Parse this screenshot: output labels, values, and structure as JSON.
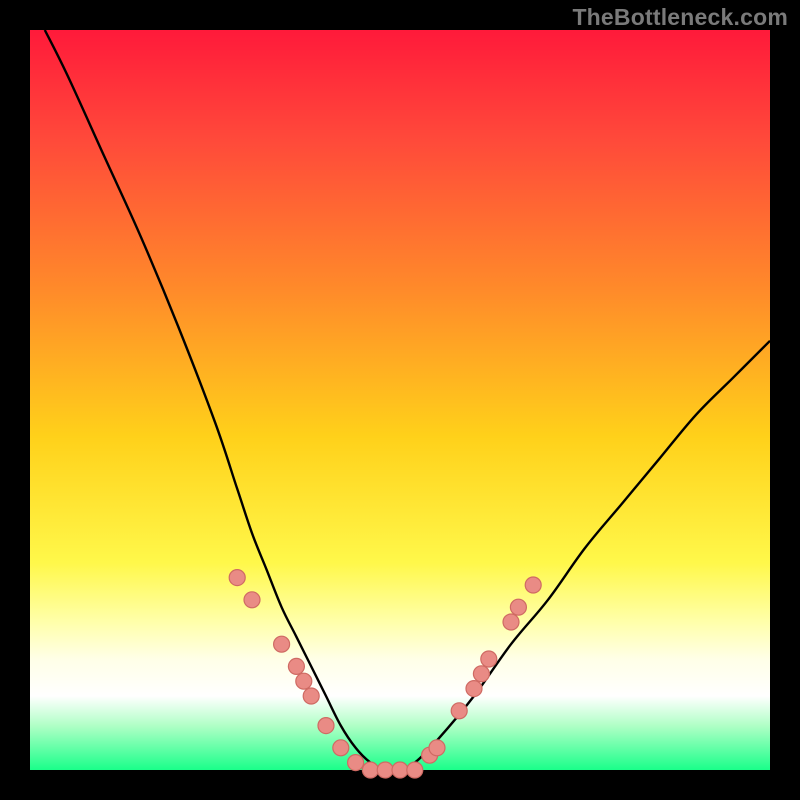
{
  "watermark": "TheBottleneck.com",
  "chart_data": {
    "type": "line",
    "title": "",
    "xlabel": "",
    "ylabel": "",
    "xlim": [
      0,
      100
    ],
    "ylim": [
      0,
      100
    ],
    "grid": false,
    "legend": false,
    "series": [
      {
        "name": "curve",
        "x": [
          2,
          5,
          10,
          15,
          20,
          25,
          28,
          30,
          32,
          34,
          36,
          38,
          40,
          42,
          44,
          46,
          48,
          50,
          52,
          55,
          60,
          65,
          70,
          75,
          80,
          85,
          90,
          95,
          100
        ],
        "values": [
          100,
          94,
          83,
          72,
          60,
          47,
          38,
          32,
          27,
          22,
          18,
          14,
          10,
          6,
          3,
          1,
          0,
          0,
          1,
          4,
          10,
          17,
          23,
          30,
          36,
          42,
          48,
          53,
          58
        ]
      }
    ],
    "markers": [
      {
        "x": 28,
        "y": 26
      },
      {
        "x": 30,
        "y": 23
      },
      {
        "x": 34,
        "y": 17
      },
      {
        "x": 36,
        "y": 14
      },
      {
        "x": 37,
        "y": 12
      },
      {
        "x": 38,
        "y": 10
      },
      {
        "x": 40,
        "y": 6
      },
      {
        "x": 42,
        "y": 3
      },
      {
        "x": 44,
        "y": 1
      },
      {
        "x": 46,
        "y": 0
      },
      {
        "x": 48,
        "y": 0
      },
      {
        "x": 50,
        "y": 0
      },
      {
        "x": 52,
        "y": 0
      },
      {
        "x": 54,
        "y": 2
      },
      {
        "x": 55,
        "y": 3
      },
      {
        "x": 58,
        "y": 8
      },
      {
        "x": 60,
        "y": 11
      },
      {
        "x": 61,
        "y": 13
      },
      {
        "x": 62,
        "y": 15
      },
      {
        "x": 65,
        "y": 20
      },
      {
        "x": 66,
        "y": 22
      },
      {
        "x": 68,
        "y": 25
      }
    ],
    "colors": {
      "curve": "#000000",
      "marker_fill": "#e98b85",
      "marker_stroke": "#cf6a63"
    },
    "marker_radius": 8
  }
}
